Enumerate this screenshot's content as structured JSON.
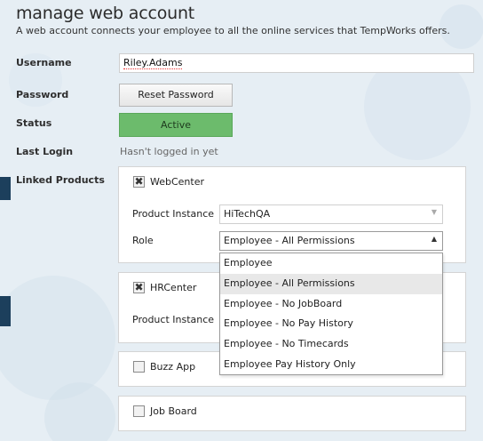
{
  "header": {
    "title": "manage web account",
    "subtitle": "A web account connects your employee to all the online services that TempWorks offers."
  },
  "form": {
    "username_label": "Username",
    "username_value": "Riley.Adams",
    "password_label": "Password",
    "reset_password_label": "Reset Password",
    "status_label": "Status",
    "status_value": "Active",
    "last_login_label": "Last Login",
    "last_login_value": "Hasn't logged in yet",
    "linked_products_label": "Linked Products"
  },
  "products": {
    "webcenter": {
      "name": "WebCenter",
      "checked": true,
      "product_instance_label": "Product Instance",
      "product_instance_value": "HiTechQA",
      "role_label": "Role",
      "role_value": "Employee - All Permissions"
    },
    "hrcenter": {
      "name": "HRCenter",
      "checked": true,
      "product_instance_label": "Product Instance"
    },
    "buzzapp": {
      "name": "Buzz App",
      "checked": false
    },
    "jobboard": {
      "name": "Job Board",
      "checked": false
    }
  },
  "role_dropdown": {
    "options": [
      "Employee",
      "Employee - All Permissions",
      "Employee - No JobBoard",
      "Employee - No Pay History",
      "Employee - No Timecards",
      "Employee Pay History Only"
    ],
    "selected_index": 1
  },
  "icons": {
    "checked_mark": "✖",
    "caret_down": "▼",
    "caret_up": "▲"
  },
  "colors": {
    "status_active": "#6cbb6c",
    "accent_tab": "#1c3f5c"
  }
}
